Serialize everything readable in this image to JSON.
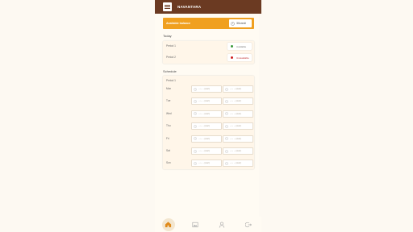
{
  "app": {
    "title": "NAVANTARA"
  },
  "balance": {
    "label": "Available balance",
    "amount": "30credi"
  },
  "today": {
    "title": "Today",
    "rows": [
      {
        "label": "Period 1",
        "status": "Available",
        "color": "#3a9a3a"
      },
      {
        "label": "Period 2",
        "status": "Unavailable",
        "color": "#d02020"
      }
    ]
  },
  "schedule": {
    "title": "Schedule",
    "period_label": "Period 1",
    "placeholder": "--:-- -- (start)",
    "days": [
      "Mon",
      "Tue",
      "Wed",
      "Thu",
      "Fri",
      "Sat",
      "Sun"
    ]
  },
  "nav": {
    "items": [
      "home-icon",
      "gallery-icon",
      "person-icon",
      "logout-icon"
    ],
    "active_color": "#e08a1a"
  },
  "colors": {
    "header": "#6b3a22",
    "accent": "#f0a020",
    "page": "#fdf9f2"
  }
}
